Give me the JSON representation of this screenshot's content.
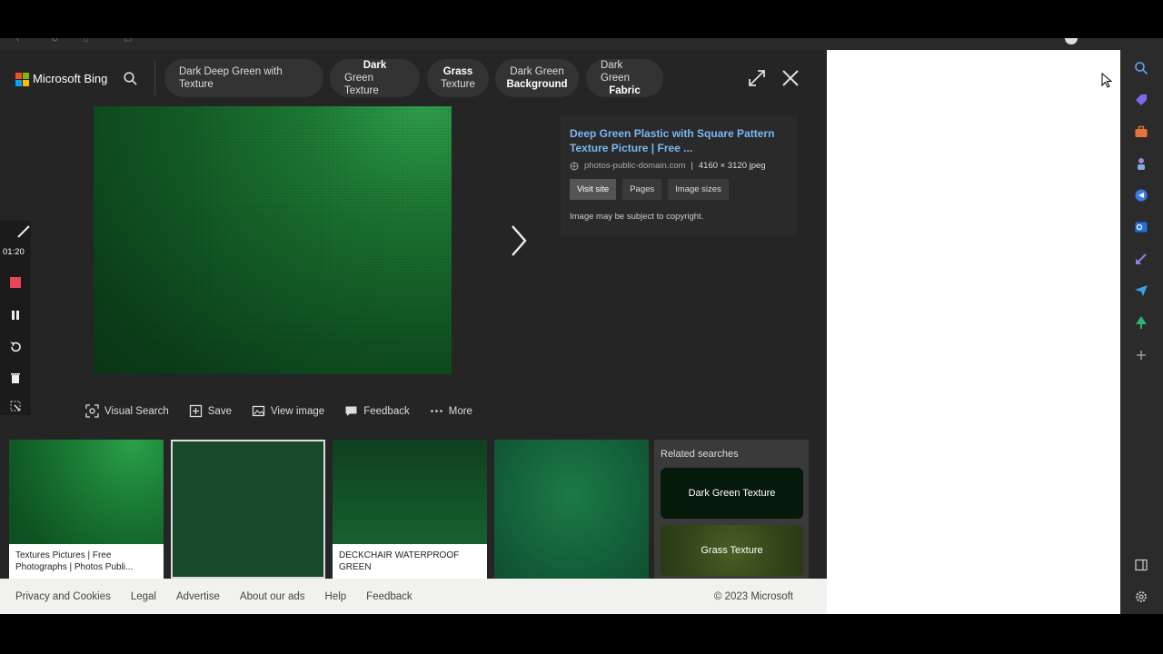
{
  "header": {
    "brand": "Microsoft Bing",
    "chips": [
      {
        "line1": "Dark Deep Green with Texture",
        "line2": ""
      },
      {
        "line1": "Dark",
        "line2": "Green Texture"
      },
      {
        "line1": "Grass",
        "line2": "Texture"
      },
      {
        "line1": "Dark Green",
        "line2": "Background"
      },
      {
        "line1": "Dark Green",
        "line2": "Fabric"
      }
    ]
  },
  "recorder": {
    "time": "01:20"
  },
  "info": {
    "title": "Deep Green Plastic with Square Pattern Texture Picture | Free ...",
    "domain": "photos-public-domain.com",
    "separator": "|",
    "dimensions": "4160 × 3120 jpeg",
    "buttons": [
      "Visit site",
      "Pages",
      "Image sizes"
    ],
    "copyright": "Image may be subject to copyright."
  },
  "actions": [
    "Visual Search",
    "Save",
    "View image",
    "Feedback",
    "More"
  ],
  "thumbnails": {
    "caption1_line1": "Textures Pictures | Free",
    "caption1_line2": "Photographs | Photos Publi...",
    "caption3": "DECKCHAIR WATERPROOF GREEN"
  },
  "related": {
    "heading": "Related searches",
    "items": [
      "Dark Green Texture",
      "Grass Texture"
    ]
  },
  "footer": {
    "links": [
      "Privacy and Cookies",
      "Legal",
      "Advertise",
      "About our ads",
      "Help",
      "Feedback"
    ],
    "copyright": "© 2023 Microsoft"
  },
  "colors": {
    "link_blue": "#79b8f3",
    "ms_red": "#f25022",
    "ms_green": "#7fba00",
    "ms_blue": "#00a4ef",
    "ms_yellow": "#ffb900",
    "record_red": "#e8475a"
  }
}
